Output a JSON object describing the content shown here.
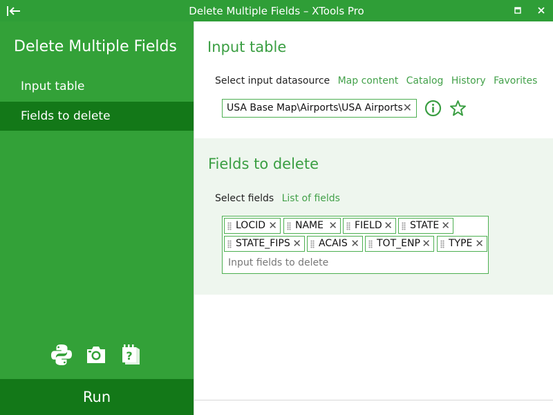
{
  "window": {
    "title": "Delete Multiple Fields – XTools Pro",
    "titlebar_color": "#2f9e37"
  },
  "sidebar": {
    "heading": "Delete Multiple Fields",
    "items": [
      {
        "label": "Input table",
        "active": false
      },
      {
        "label": "Fields to delete",
        "active": true
      }
    ],
    "tools": [
      "python-icon",
      "camera-icon",
      "help-icon"
    ],
    "run_label": "Run",
    "bg_color": "#33a138",
    "active_color": "#137818"
  },
  "input_table": {
    "title": "Input table",
    "select_label": "Select input datasource",
    "links": [
      "Map content",
      "Catalog",
      "History",
      "Favorites"
    ],
    "datasource_value": "USA Base Map\\Airports\\USA Airports"
  },
  "fields_to_delete": {
    "title": "Fields to delete",
    "select_label": "Select fields",
    "link": "List of fields",
    "fields": [
      "LOCID",
      "NAME",
      "FIELD",
      "STATE",
      "STATE_FIPS",
      "ACAIS",
      "TOT_ENP",
      "TYPE"
    ],
    "placeholder": "Input fields to delete"
  }
}
